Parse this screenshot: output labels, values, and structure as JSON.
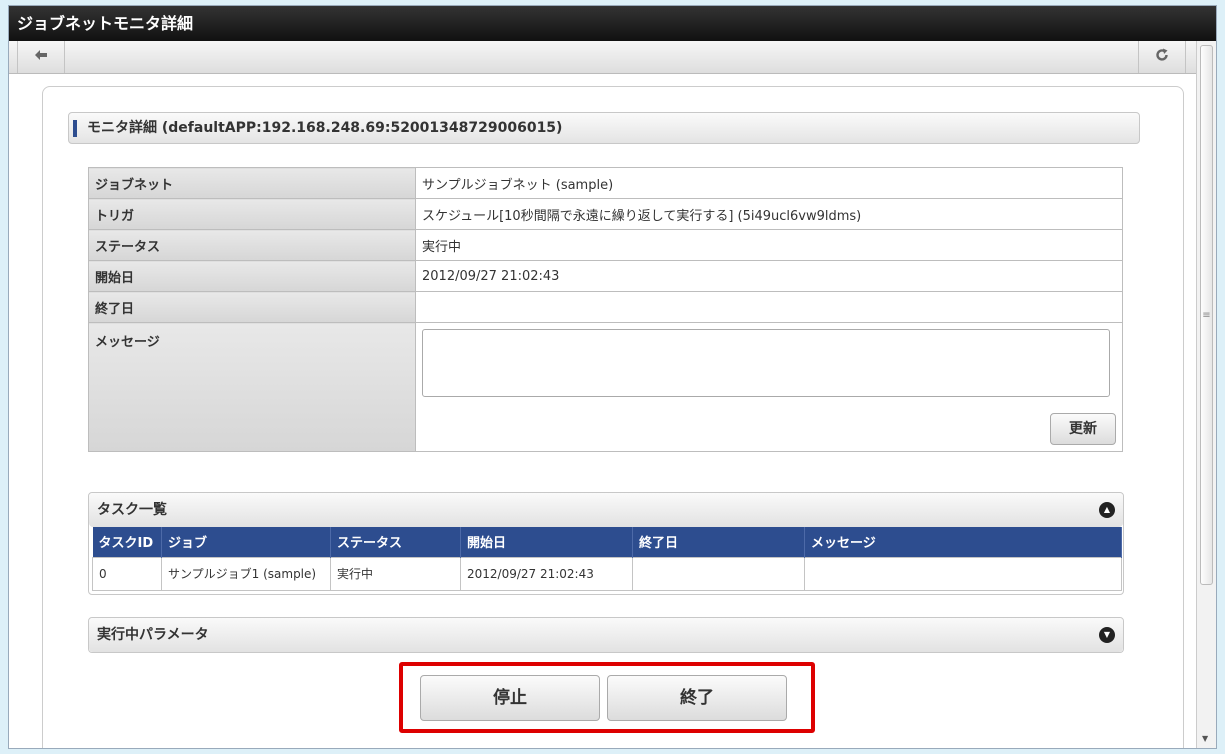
{
  "window": {
    "title": "ジョブネットモニタ詳細"
  },
  "toolbar": {
    "back_icon": "back-arrow-icon",
    "reload_icon": "reload-icon"
  },
  "section": {
    "title": "モニタ詳細 (defaultAPP:192.168.248.69:52001348729006015)"
  },
  "detail": {
    "jobnet_label": "ジョブネット",
    "jobnet_value": "サンプルジョブネット (sample)",
    "trigger_label": "トリガ",
    "trigger_value": "スケジュール[10秒間隔で永遠に繰り返して実行する] (5i49ucl6vw9ldms)",
    "status_label": "ステータス",
    "status_value": "実行中",
    "start_label": "開始日",
    "start_value": "2012/09/27 21:02:43",
    "end_label": "終了日",
    "end_value": "",
    "message_label": "メッセージ",
    "message_value": "",
    "update_label": "更新"
  },
  "tasks": {
    "title": "タスク一覧",
    "columns": [
      "タスクID",
      "ジョブ",
      "ステータス",
      "開始日",
      "終了日",
      "メッセージ"
    ],
    "rows": [
      [
        "0",
        "サンプルジョブ1 (sample)",
        "実行中",
        "2012/09/27 21:02:43",
        "",
        ""
      ]
    ]
  },
  "params": {
    "title": "実行中パラメータ"
  },
  "actions": {
    "stop_label": "停止",
    "end_label": "終了"
  }
}
